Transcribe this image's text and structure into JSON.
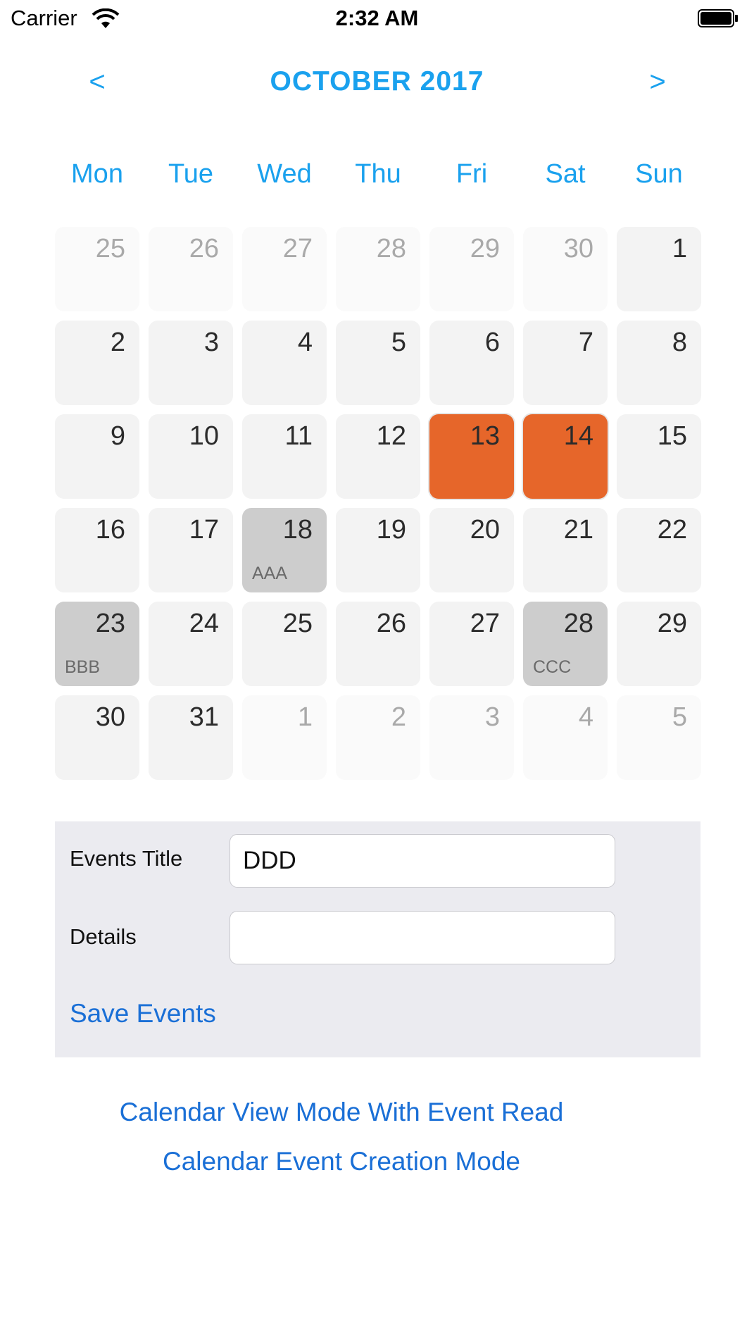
{
  "status": {
    "carrier": "Carrier",
    "time": "2:32 AM"
  },
  "calendar": {
    "title": "OCTOBER 2017",
    "prev_label": "<",
    "next_label": ">",
    "weekdays": [
      "Mon",
      "Tue",
      "Wed",
      "Thu",
      "Fri",
      "Sat",
      "Sun"
    ],
    "weeks": [
      [
        {
          "day": "25",
          "state": "muted",
          "event": ""
        },
        {
          "day": "26",
          "state": "muted",
          "event": ""
        },
        {
          "day": "27",
          "state": "muted",
          "event": ""
        },
        {
          "day": "28",
          "state": "muted",
          "event": ""
        },
        {
          "day": "29",
          "state": "muted",
          "event": ""
        },
        {
          "day": "30",
          "state": "muted",
          "event": ""
        },
        {
          "day": "1",
          "state": "normal",
          "event": ""
        }
      ],
      [
        {
          "day": "2",
          "state": "normal",
          "event": ""
        },
        {
          "day": "3",
          "state": "normal",
          "event": ""
        },
        {
          "day": "4",
          "state": "normal",
          "event": ""
        },
        {
          "day": "5",
          "state": "normal",
          "event": ""
        },
        {
          "day": "6",
          "state": "normal",
          "event": ""
        },
        {
          "day": "7",
          "state": "normal",
          "event": ""
        },
        {
          "day": "8",
          "state": "normal",
          "event": ""
        }
      ],
      [
        {
          "day": "9",
          "state": "normal",
          "event": ""
        },
        {
          "day": "10",
          "state": "normal",
          "event": ""
        },
        {
          "day": "11",
          "state": "normal",
          "event": ""
        },
        {
          "day": "12",
          "state": "normal",
          "event": ""
        },
        {
          "day": "13",
          "state": "selected",
          "event": ""
        },
        {
          "day": "14",
          "state": "selected",
          "event": ""
        },
        {
          "day": "15",
          "state": "normal",
          "event": ""
        }
      ],
      [
        {
          "day": "16",
          "state": "normal",
          "event": ""
        },
        {
          "day": "17",
          "state": "normal",
          "event": ""
        },
        {
          "day": "18",
          "state": "event",
          "event": "AAA"
        },
        {
          "day": "19",
          "state": "normal",
          "event": ""
        },
        {
          "day": "20",
          "state": "normal",
          "event": ""
        },
        {
          "day": "21",
          "state": "normal",
          "event": ""
        },
        {
          "day": "22",
          "state": "normal",
          "event": ""
        }
      ],
      [
        {
          "day": "23",
          "state": "event",
          "event": "BBB"
        },
        {
          "day": "24",
          "state": "normal",
          "event": ""
        },
        {
          "day": "25",
          "state": "normal",
          "event": ""
        },
        {
          "day": "26",
          "state": "normal",
          "event": ""
        },
        {
          "day": "27",
          "state": "normal",
          "event": ""
        },
        {
          "day": "28",
          "state": "event",
          "event": "CCC"
        },
        {
          "day": "29",
          "state": "normal",
          "event": ""
        }
      ],
      [
        {
          "day": "30",
          "state": "normal",
          "event": ""
        },
        {
          "day": "31",
          "state": "normal",
          "event": ""
        },
        {
          "day": "1",
          "state": "muted",
          "event": ""
        },
        {
          "day": "2",
          "state": "muted",
          "event": ""
        },
        {
          "day": "3",
          "state": "muted",
          "event": ""
        },
        {
          "day": "4",
          "state": "muted",
          "event": ""
        },
        {
          "day": "5",
          "state": "muted",
          "event": ""
        }
      ]
    ]
  },
  "form": {
    "title_label": "Events Title",
    "title_value": "DDD",
    "details_label": "Details",
    "details_value": "",
    "save_label": "Save Events"
  },
  "modes": {
    "read_label": "Calendar View Mode With Event Read",
    "create_label": "Calendar Event Creation Mode"
  },
  "colors": {
    "accent": "#1aa1ee",
    "link": "#1a6fd6",
    "selected": "#e6662a",
    "event_cell": "#cdcdcd"
  }
}
